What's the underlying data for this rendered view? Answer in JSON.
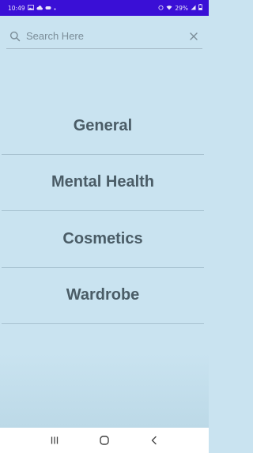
{
  "status_bar": {
    "time": "10:49",
    "right_text": "29%"
  },
  "search": {
    "placeholder": "Search Here",
    "value": ""
  },
  "categories": [
    {
      "label": "General"
    },
    {
      "label": "Mental Health"
    },
    {
      "label": "Cosmetics"
    },
    {
      "label": "Wardrobe"
    }
  ],
  "icons": {
    "search": "search-icon",
    "clear": "close-icon",
    "nav_recent": "recent-apps-icon",
    "nav_home": "home-icon",
    "nav_back": "back-icon"
  },
  "colors": {
    "status_bar": "#3a0fd6",
    "background": "#c9e3f0",
    "category_text": "#4a5c66",
    "divider": "#a6c1cf"
  }
}
